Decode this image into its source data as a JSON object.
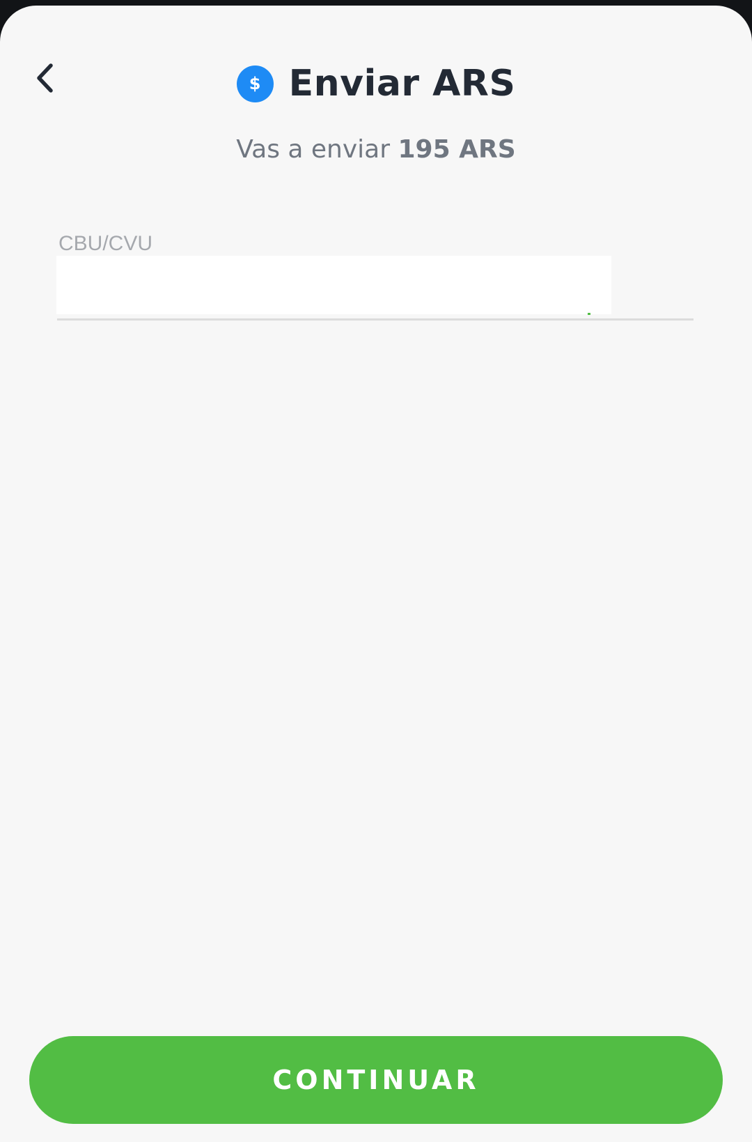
{
  "header": {
    "title": "Enviar ARS",
    "coin_symbol": "$",
    "back_icon": "chevron-left-icon",
    "coin_icon_color": "#1e8bf5"
  },
  "summary": {
    "prefix": "Vas a enviar",
    "amount": "195 ARS"
  },
  "form": {
    "cbu_label": "CBU/CVU",
    "cbu_value": "",
    "cbu_placeholder": ""
  },
  "actions": {
    "continue_label": "CONTINUAR",
    "continue_color": "#52bd44"
  }
}
